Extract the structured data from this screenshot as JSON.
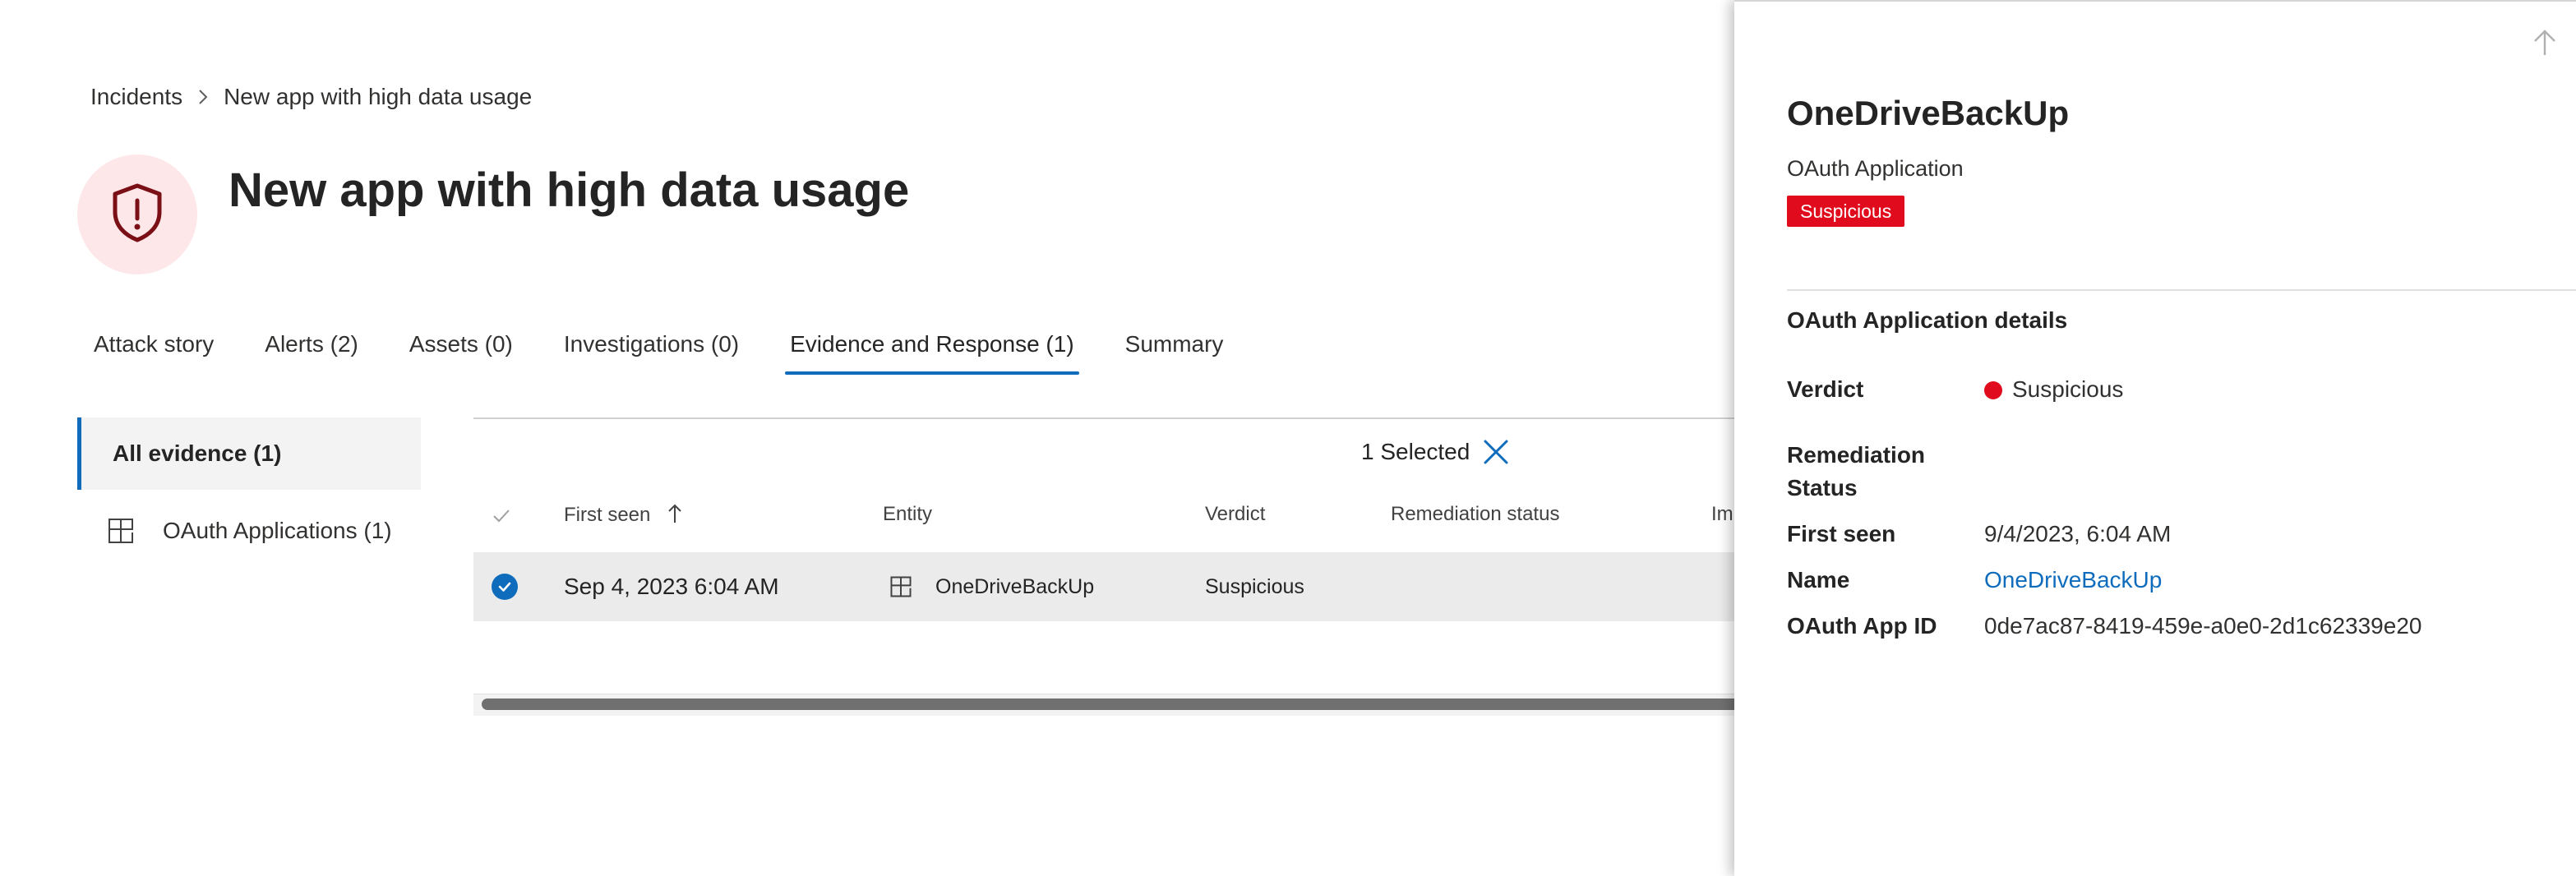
{
  "breadcrumb": {
    "root": "Incidents",
    "current": "New app with high data usage"
  },
  "page": {
    "title": "New app with high data usage"
  },
  "tabs": [
    {
      "label": "Attack story"
    },
    {
      "label": "Alerts (2)"
    },
    {
      "label": "Assets (0)"
    },
    {
      "label": "Investigations (0)"
    },
    {
      "label": "Evidence and Response (1)",
      "active": true
    },
    {
      "label": "Summary"
    }
  ],
  "evidence_nav": {
    "all": "All evidence (1)",
    "oauth": "OAuth Applications (1)"
  },
  "table": {
    "selected_text": "1 Selected",
    "columns": {
      "first_seen": "First seen",
      "entity": "Entity",
      "verdict": "Verdict",
      "remediation_status": "Remediation status",
      "truncated": "Im"
    },
    "rows": [
      {
        "first_seen": "Sep 4, 2023 6:04 AM",
        "entity": "OneDriveBackUp",
        "verdict": "Suspicious",
        "remediation_status": ""
      }
    ]
  },
  "panel": {
    "title": "OneDriveBackUp",
    "subtitle": "OAuth Application",
    "badge": "Suspicious",
    "section_title": "OAuth Application details",
    "details": {
      "verdict_label": "Verdict",
      "verdict_value": "Suspicious",
      "remediation_label": "Remediation Status",
      "remediation_value": "",
      "first_seen_label": "First seen",
      "first_seen_value": "9/4/2023, 6:04 AM",
      "name_label": "Name",
      "name_value": "OneDriveBackUp",
      "app_id_label": "OAuth App ID",
      "app_id_value": "0de7ac87-8419-459e-a0e0-2d1c62339e20"
    }
  },
  "colors": {
    "accent": "#0f6cbd",
    "suspicious": "#e00b1c",
    "header_icon_bg": "#fde7e9",
    "header_icon_fg": "#7a0f16"
  },
  "icons": {
    "breadcrumb_sep": "chevron-right-icon",
    "header": "shield-alert-icon",
    "oauth": "app-grid-icon",
    "sort": "arrow-up-icon",
    "clear_selection": "close-icon",
    "row_check": "checkmark-circle-icon",
    "panel_nav": "arrow-up-icon"
  }
}
